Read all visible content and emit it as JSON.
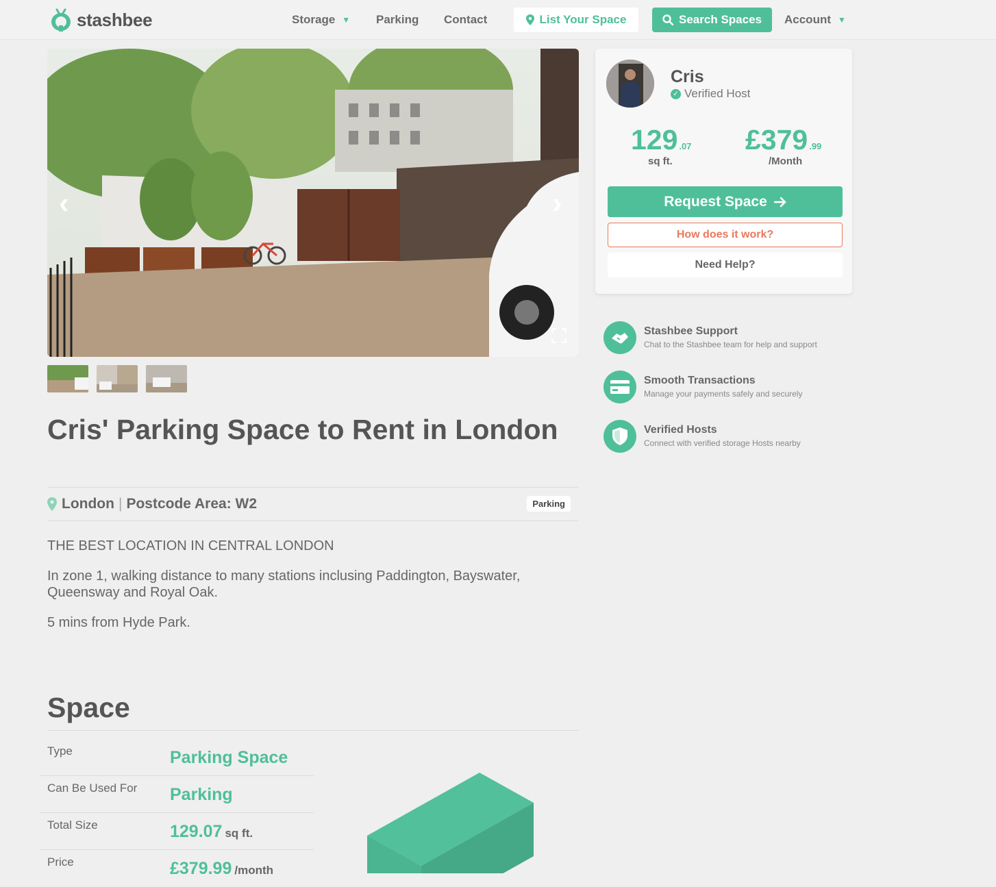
{
  "header": {
    "brand": "stashbee",
    "nav": [
      {
        "label": "Storage"
      },
      {
        "label": "Parking"
      },
      {
        "label": "Contact"
      }
    ],
    "list_space": "List Your Space",
    "search_spaces": "Search Spaces",
    "account": "Account"
  },
  "listing": {
    "title": "Cris' Parking Space to Rent in London",
    "city": "London",
    "separator": "|",
    "postcode": "Postcode Area: W2",
    "badge": "Parking",
    "description": [
      "THE BEST LOCATION IN CENTRAL LONDON",
      "In zone 1, walking distance to many stations inclusing Paddington, Bayswater, Queensway and Royal Oak.",
      "5 mins from Hyde Park."
    ]
  },
  "space": {
    "heading": "Space",
    "rows": [
      {
        "label": "Type",
        "value": "Parking Space",
        "unit": ""
      },
      {
        "label": "Can Be Used For",
        "value": "Parking",
        "unit": ""
      },
      {
        "label": "Total Size",
        "value": "129.07",
        "unit": "sq ft."
      },
      {
        "label": "Price",
        "value": "£379.99",
        "unit": "/month"
      }
    ]
  },
  "host": {
    "name": "Cris",
    "verified": "Verified Host",
    "size_int": "129",
    "size_dec": ".07",
    "size_unit": "sq ft.",
    "price_int": "£379",
    "price_dec": ".99",
    "price_unit": "/Month",
    "request": "Request Space",
    "how": "How does it work?",
    "help": "Need Help?"
  },
  "features": [
    {
      "title": "Stashbee Support",
      "sub": "Chat to the Stashbee team for help and support",
      "icon": "handshake-icon"
    },
    {
      "title": "Smooth Transactions",
      "sub": "Manage your payments safely and securely",
      "icon": "credit-card-icon"
    },
    {
      "title": "Verified Hosts",
      "sub": "Connect with verified storage Hosts nearby",
      "icon": "shield-icon"
    }
  ],
  "colors": {
    "accent": "#4fbf9a",
    "orange": "#e8795c"
  }
}
